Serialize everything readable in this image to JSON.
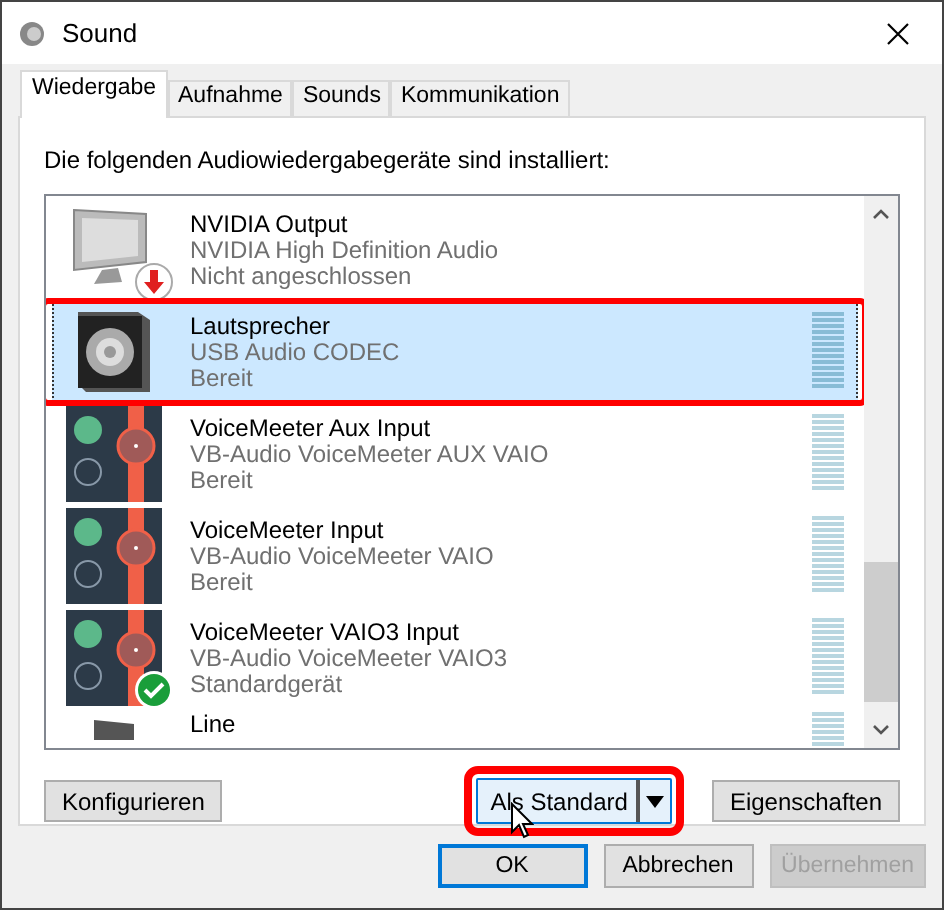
{
  "window": {
    "title": "Sound"
  },
  "tabs": [
    {
      "label": "Wiedergabe",
      "selected": true
    },
    {
      "label": "Aufnahme",
      "selected": false
    },
    {
      "label": "Sounds",
      "selected": false
    },
    {
      "label": "Kommunikation",
      "selected": false
    }
  ],
  "intro": "Die folgenden Audiowiedergabegeräte sind installiert:",
  "devices": [
    {
      "kind": "monitor",
      "name": "NVIDIA Output",
      "driver": "NVIDIA High Definition Audio",
      "status": "Nicht angeschlossen",
      "selected": false,
      "highlighted": false,
      "default": false,
      "disconnected": true
    },
    {
      "kind": "speaker",
      "name": "Lautsprecher",
      "driver": "USB Audio CODEC",
      "status": "Bereit",
      "selected": true,
      "highlighted": true,
      "default": false,
      "disconnected": false
    },
    {
      "kind": "voicemeeter",
      "name": "VoiceMeeter Aux Input",
      "driver": "VB-Audio VoiceMeeter AUX VAIO",
      "status": "Bereit",
      "selected": false,
      "highlighted": false,
      "default": false,
      "disconnected": false
    },
    {
      "kind": "voicemeeter",
      "name": "VoiceMeeter Input",
      "driver": "VB-Audio VoiceMeeter VAIO",
      "status": "Bereit",
      "selected": false,
      "highlighted": false,
      "default": false,
      "disconnected": false
    },
    {
      "kind": "voicemeeter",
      "name": "VoiceMeeter VAIO3 Input",
      "driver": "VB-Audio VoiceMeeter VAIO3",
      "status": "Standardgerät",
      "selected": false,
      "highlighted": false,
      "default": true,
      "disconnected": false
    },
    {
      "kind": "line",
      "name": "Line",
      "selected": false
    }
  ],
  "panel_buttons": [
    {
      "kind": "plain",
      "label": "Konfigurieren",
      "highlighted": false
    },
    {
      "kind": "split",
      "label": "Als Standard",
      "highlighted": true
    },
    {
      "kind": "plain",
      "label": "Eigenschaften",
      "highlighted": false
    }
  ],
  "dialog_buttons": [
    {
      "label": "OK",
      "focused": true,
      "disabled": false
    },
    {
      "label": "Abbrechen",
      "focused": false,
      "disabled": false
    },
    {
      "label": "Übernehmen",
      "focused": false,
      "disabled": true
    }
  ]
}
